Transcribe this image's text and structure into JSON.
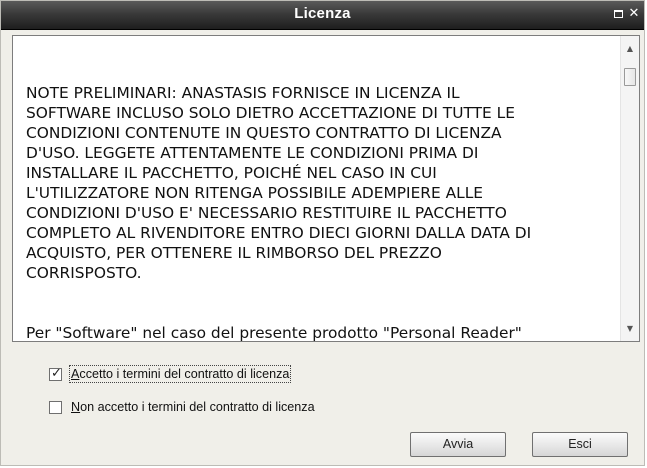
{
  "window": {
    "title": "Licenza",
    "maximize_icon": "maximize-icon",
    "close_icon": "close-icon",
    "close_glyph": "✕"
  },
  "license": {
    "paragraph1": "NOTE PRELIMINARI: ANASTASIS FORNISCE IN LICENZA IL\nSOFTWARE INCLUSO SOLO DIETRO ACCETTAZIONE DI TUTTE LE\nCONDIZIONI CONTENUTE IN QUESTO CONTRATTO DI LICENZA\nD'USO. LEGGETE ATTENTAMENTE LE CONDIZIONI PRIMA DI\nINSTALLARE IL PACCHETTO, POICHÉ NEL CASO IN CUI\nL'UTILIZZATORE NON RITENGA POSSIBILE ADEMPIERE ALLE\nCONDIZIONI D'USO E' NECESSARIO RESTITUIRE IL PACCHETTO\nCOMPLETO AL RIVENDITORE ENTRO DIECI GIORNI DALLA DATA DI\nACQUISTO, PER OTTENERE IL RIMBORSO DEL PREZZO\nCORRISPOSTO.",
    "paragraph2": "Per \"Software\" nel caso del presente prodotto \"Personal Reader\""
  },
  "scrollbar": {
    "up_glyph": "▲",
    "down_glyph": "▼"
  },
  "options": {
    "accept": {
      "label": "Accetto i termini del contratto di licenza",
      "checked": true,
      "check_glyph": "✓"
    },
    "decline": {
      "label": "Non accetto i termini del contratto di licenza",
      "checked": false
    }
  },
  "buttons": {
    "start_label": "Avvia",
    "exit_label": "Esci"
  }
}
